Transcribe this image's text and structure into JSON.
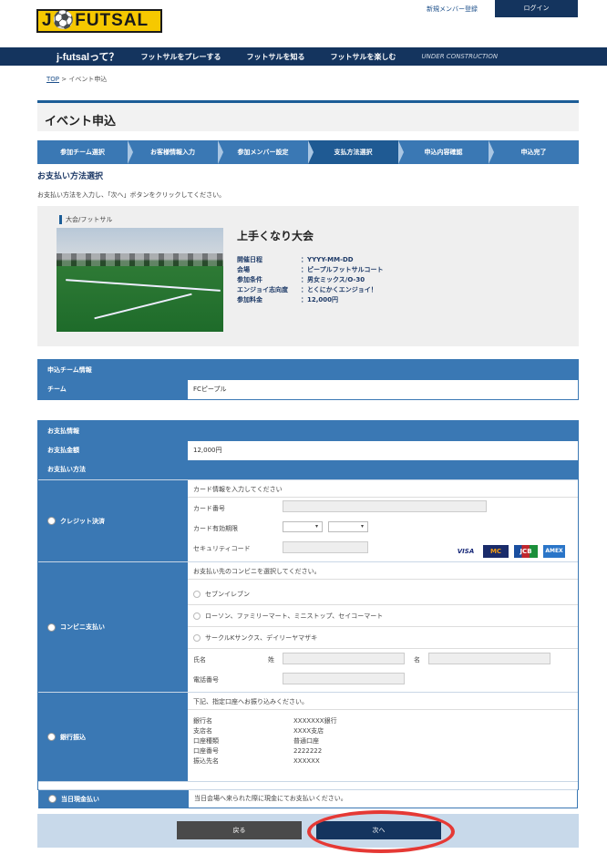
{
  "header": {
    "logo": "J⚽FUTSAL",
    "register_link": "新規メンバー登録",
    "login_button": "ログイン"
  },
  "nav": {
    "brand": "j-futsalって？",
    "items": [
      "フットサルをプレーする",
      "フットサルを知る",
      "フットサルを楽しむ"
    ],
    "muted": "UNDER CONSTRUCTION"
  },
  "breadcrumb": {
    "top": "TOP",
    "current": "> イベント申込"
  },
  "page_title": "イベント申込",
  "steps": [
    "参加チーム選択",
    "お客様情報入力",
    "参加メンバー設定",
    "支払方法選択",
    "申込内容確認",
    "申込完了"
  ],
  "active_step_index": 3,
  "section_heading": "お支払い方法選択",
  "instructions": "お支払い方法を入力し、「次へ」ボタンをクリックしてください。",
  "event": {
    "category": "大会/フットサル",
    "name": "上手くなり大会",
    "details": [
      {
        "label": "開催日程",
        "value": "：YYYY-MM-DD"
      },
      {
        "label": "会場",
        "value": "：ピープルフットサルコート"
      },
      {
        "label": "参加条件",
        "value": "：男女ミックス/O-30"
      },
      {
        "label": "エンジョイ志向度",
        "value": "：とくにかくエンジョイ！"
      },
      {
        "label": "参加料金",
        "value": "：12,000円"
      }
    ]
  },
  "team_panel": {
    "heading": "申込チーム情報",
    "row_label": "チーム",
    "row_value": "FCピープル"
  },
  "payment_panel": {
    "heading": "お支払情報",
    "amount_label": "お支払金額",
    "amount_value": "12,000円",
    "method_label": "お支払い方法",
    "credit": {
      "label": "クレジット決済",
      "note": "カード情報を入力してください",
      "card_number_label": "カード番号",
      "expiry_label": "カード有効期限",
      "security_label": "セキュリティコード",
      "select_arrow": "▾",
      "card_brands": [
        "VISA",
        "MC",
        "JCB",
        "AMEX"
      ]
    },
    "convenience": {
      "label": "コンビニ支払い",
      "note": "お支払い先のコンビニを選択してください。",
      "options": [
        "セブンイレブン",
        "ローソン、ファミリーマート、ミニストップ、セイコーマート",
        "サークルKサンクス、デイリーヤマザキ"
      ],
      "name_label": "氏名",
      "last_name_label": "姓",
      "first_name_label": "名",
      "phone_label": "電話番号"
    },
    "bank": {
      "label": "銀行振込",
      "note": "下記、指定口座へお振り込みください。",
      "rows": [
        {
          "label": "銀行名",
          "value": "XXXXXXX銀行"
        },
        {
          "label": "支店名",
          "value": "XXXX支店"
        },
        {
          "label": "口座種類",
          "value": "普通口座"
        },
        {
          "label": "口座番号",
          "value": "2222222"
        },
        {
          "label": "振込先名",
          "value": "XXXXXX"
        }
      ]
    },
    "onsite": {
      "label": "当日現金払い",
      "note": "当日会場へ来られた際に現金にてお支払いください。"
    }
  },
  "buttons": {
    "back": "戻る",
    "next": "次へ"
  },
  "colors": {
    "navy": "#14345e",
    "accent": "#3a78b4",
    "logo_yellow": "#f6c800",
    "highlight": "#e53935"
  }
}
